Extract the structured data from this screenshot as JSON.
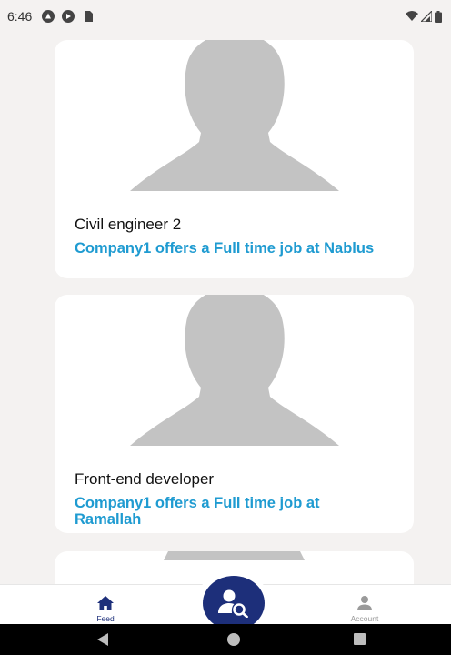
{
  "status_bar": {
    "time": "6:46",
    "icons": [
      "notification-icon",
      "play-icon",
      "sd-card-icon",
      "wifi-icon",
      "signal-icon",
      "battery-icon"
    ]
  },
  "feed": {
    "cards": [
      {
        "title": "Civil engineer 2",
        "description": "Company1 offers a Full time job at Nablus",
        "image": "person-placeholder-icon"
      },
      {
        "title": "Front-end developer",
        "description": "Company1 offers a Full time job at Ramallah",
        "image": "person-placeholder-icon"
      }
    ]
  },
  "bottom_nav": {
    "feed_label": "Feed",
    "account_label": "Account",
    "feed_icon": "home-icon",
    "account_icon": "person-icon",
    "fab_icon": "search-people-icon"
  },
  "colors": {
    "primary": "#1d2f7a",
    "link": "#1f9bd1",
    "background": "#f4f2f1",
    "placeholder": "#c3c3c3"
  }
}
